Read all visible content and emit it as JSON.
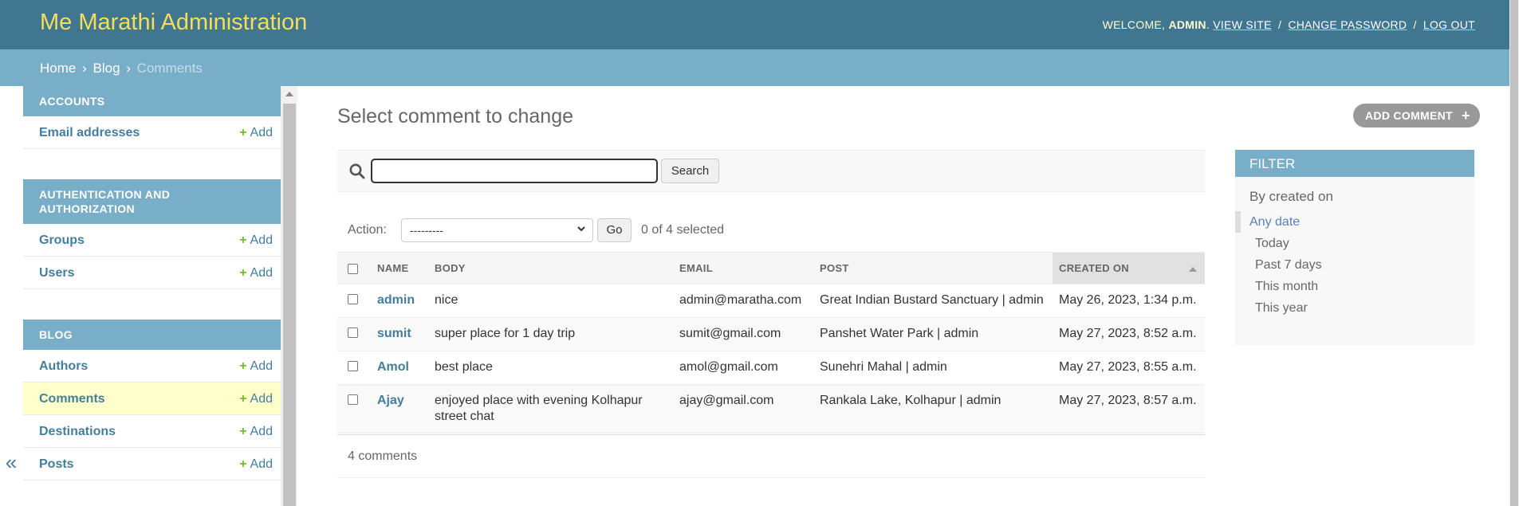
{
  "header": {
    "branding": "Me Marathi Administration",
    "welcome": "WELCOME,",
    "username": "ADMIN",
    "view_site": "VIEW SITE",
    "change_password": "CHANGE PASSWORD",
    "log_out": "LOG OUT",
    "sep": "/"
  },
  "breadcrumbs": {
    "home": "Home",
    "blog": "Blog",
    "current": "Comments",
    "sep": "›"
  },
  "sidebar": {
    "toggle": "«",
    "add_label": "Add",
    "modules": [
      {
        "caption": "ACCOUNTS",
        "models": [
          "Email addresses"
        ]
      },
      {
        "caption": "AUTHENTICATION AND AUTHORIZATION",
        "models": [
          "Groups",
          "Users"
        ]
      },
      {
        "caption": "BLOG",
        "models": [
          "Authors",
          "Comments",
          "Destinations",
          "Posts"
        ]
      }
    ]
  },
  "content": {
    "title": "Select comment to change",
    "add_button": "ADD COMMENT",
    "search_button": "Search",
    "search_value": "",
    "action_label": "Action:",
    "action_selected": "---------",
    "go_button": "Go",
    "selected_count": "0 of 4 selected",
    "columns": [
      "NAME",
      "BODY",
      "EMAIL",
      "POST",
      "CREATED ON"
    ],
    "rows": [
      {
        "name": "admin",
        "body": "nice",
        "email": "admin@maratha.com",
        "post": "Great Indian Bustard Sanctuary | admin",
        "created_on": "May 26, 2023, 1:34 p.m."
      },
      {
        "name": "sumit",
        "body": "super place for 1 day trip",
        "email": "sumit@gmail.com",
        "post": "Panshet Water Park | admin",
        "created_on": "May 27, 2023, 8:52 a.m."
      },
      {
        "name": "Amol",
        "body": "best place",
        "email": "amol@gmail.com",
        "post": "Sunehri Mahal | admin",
        "created_on": "May 27, 2023, 8:55 a.m."
      },
      {
        "name": "Ajay",
        "body": "enjoyed place with evening Kolhapur street chat",
        "email": "ajay@gmail.com",
        "post": "Rankala Lake, Kolhapur | admin",
        "created_on": "May 27, 2023, 8:57 a.m."
      }
    ],
    "paginator": "4 comments"
  },
  "filter": {
    "title": "FILTER",
    "heading": "By created on",
    "options": [
      "Any date",
      "Today",
      "Past 7 days",
      "This month",
      "This year"
    ],
    "selected": "Any date"
  },
  "colors": {
    "header_bg": "#417690",
    "branding": "#f5dd5d",
    "breadcrumb_bg": "#79aec8",
    "link": "#447e9b",
    "add_plus": "#70bf2b",
    "current_row": "#ffffcc"
  }
}
